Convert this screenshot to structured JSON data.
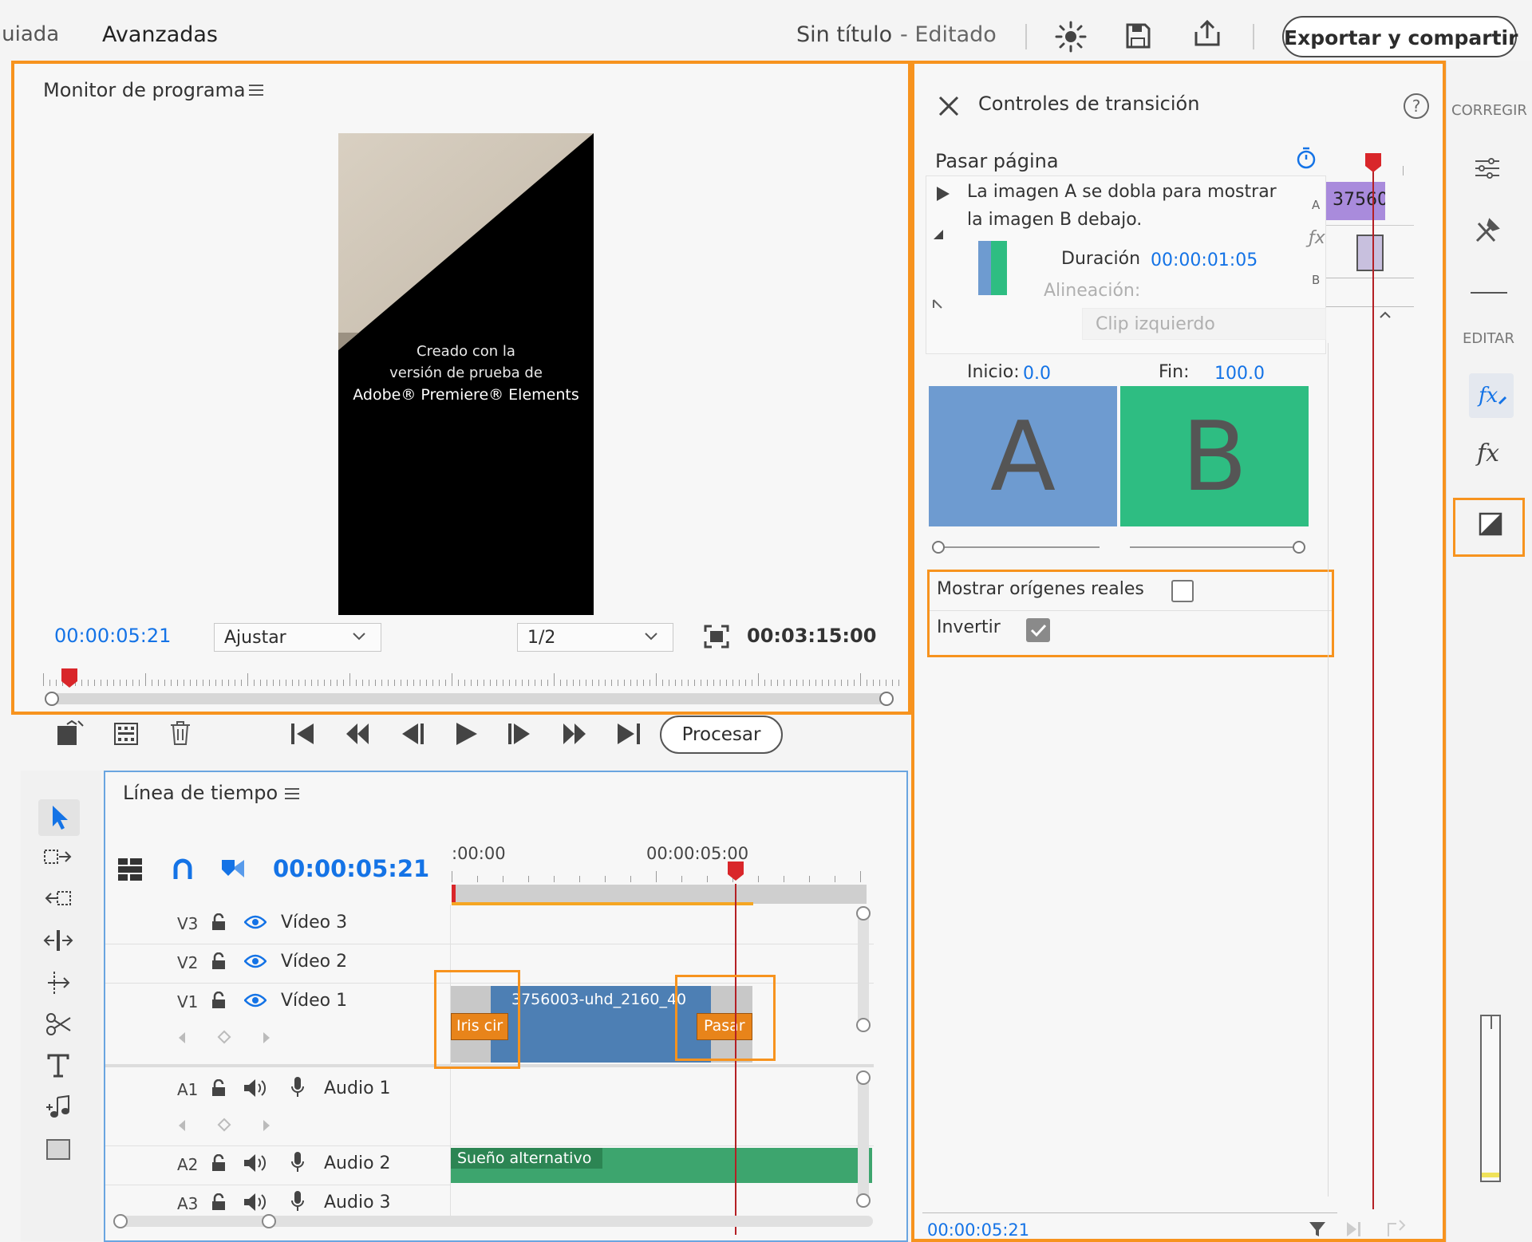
{
  "header": {
    "tab_guided": "Guiada",
    "tab_advanced": "Avanzadas",
    "doc_title": "Sin título",
    "doc_status": "- Editado",
    "export_button": "Exportar y compartir"
  },
  "program_monitor": {
    "title": "Monitor de programa",
    "watermark_line1": "Creado con la",
    "watermark_line2": "versión de prueba de",
    "watermark_line3": "Adobe® Premiere® Elements",
    "current_time": "00:00:05:21",
    "fit_select": "Ajustar",
    "resolution_select": "1/2",
    "duration": "00:03:15:00"
  },
  "transport": {
    "render_button": "Procesar"
  },
  "timeline": {
    "title": "Línea de tiempo",
    "current_time": "00:00:05:21",
    "ruler_start": ":00:00",
    "ruler_mark": "00:00:05:00",
    "tracks": [
      {
        "id": "V3",
        "name": "Vídeo 3"
      },
      {
        "id": "V2",
        "name": "Vídeo 2"
      },
      {
        "id": "V1",
        "name": "Vídeo 1"
      },
      {
        "id": "A1",
        "name": "Audio 1"
      },
      {
        "id": "A2",
        "name": "Audio 2"
      },
      {
        "id": "A3",
        "name": "Audio 3"
      }
    ],
    "video_clip_name": "3756003-uhd_2160_40",
    "transition_left": "Iris cir",
    "transition_right": "Pasar",
    "audio_clip_name": "Sueño alternativo"
  },
  "transition_controls": {
    "title": "Controles de transición",
    "transition_name": "Pasar página",
    "description_line1": "La imagen A se dobla para mostrar",
    "description_line2": "la imagen B debajo.",
    "duration_label": "Duración",
    "duration_value": "00:00:01:05",
    "alignment_label": "Alineación:",
    "alignment_value": "Clip izquierdo",
    "start_label": "Inicio:",
    "start_value": "0.0",
    "end_label": "Fin:",
    "end_value": "100.0",
    "preview_a": "A",
    "preview_b": "B",
    "show_actual_sources_label": "Mostrar orígenes reales",
    "show_actual_sources_checked": false,
    "reverse_label": "Invertir",
    "reverse_checked": true,
    "mini_clip_label": "37560",
    "track_label_a": "A",
    "track_label_b": "B",
    "bottom_time": "00:00:05:21"
  },
  "right_toolbar": {
    "section_correct": "CORREGIR",
    "section_edit": "EDITAR"
  },
  "colors": {
    "accent_orange": "#f7931e",
    "blue_time": "#1473e6",
    "preview_a": "#6e9bd0",
    "preview_b": "#2ebd82",
    "playhead": "#d9262a",
    "clip_blue": "#4d7fb4",
    "audio_green": "#3da56e",
    "transition_orange": "#e8841a"
  }
}
